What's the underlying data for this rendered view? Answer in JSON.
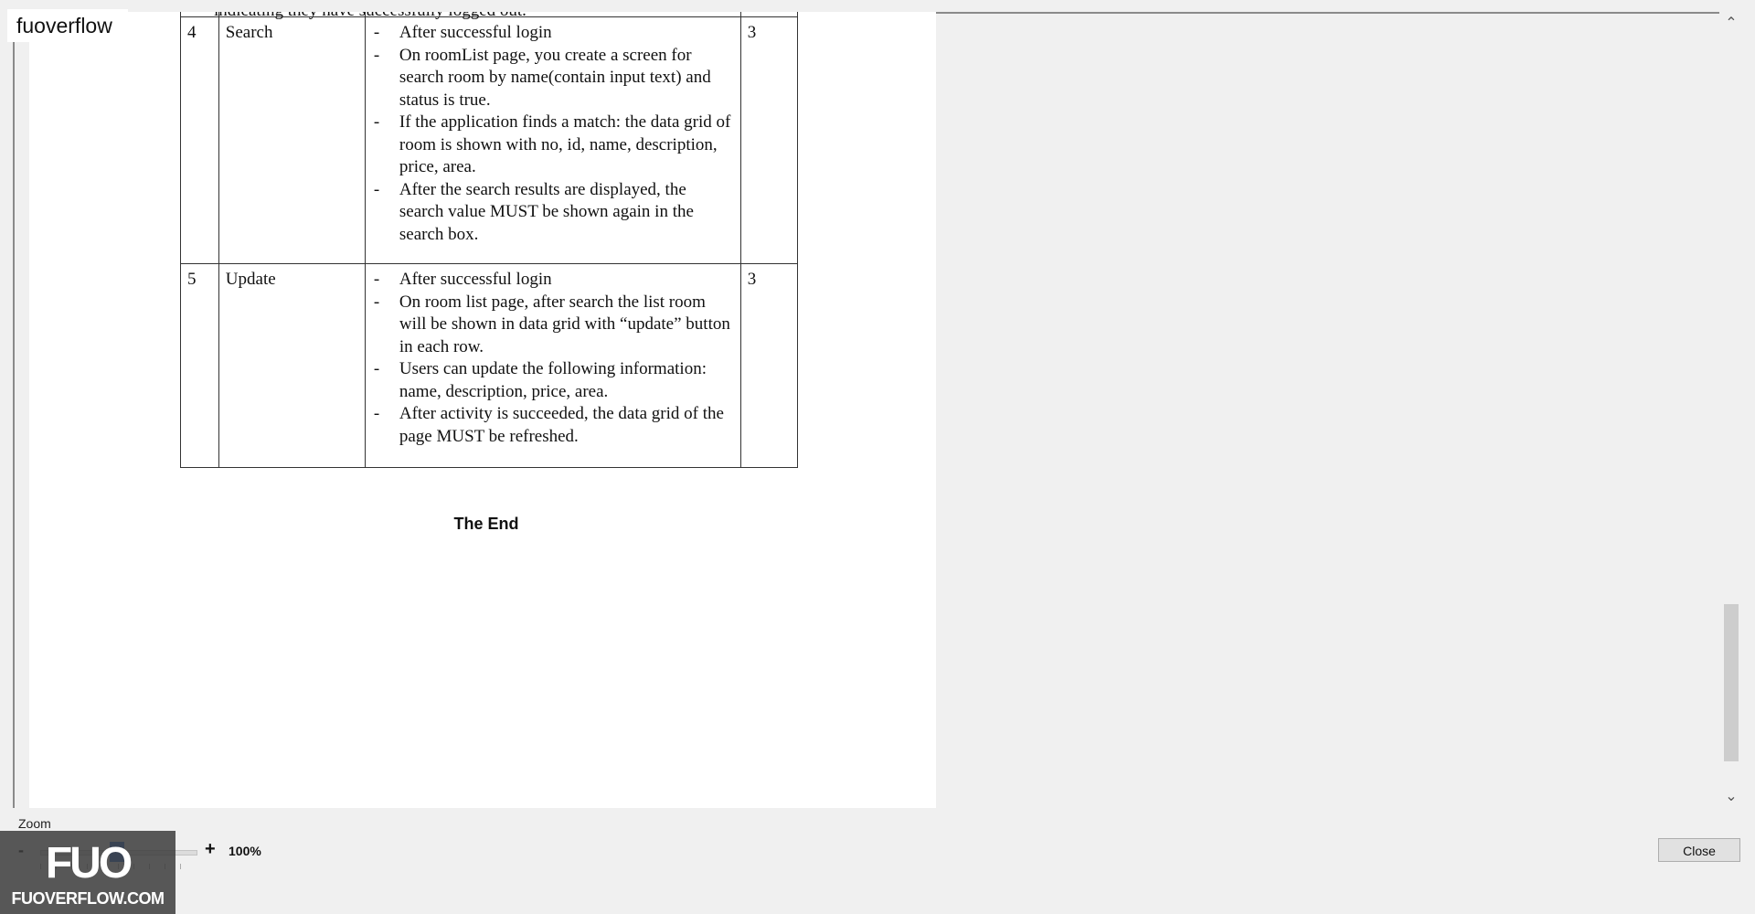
{
  "watermark": {
    "label": "fuoverflow",
    "logo_mark": "FUO",
    "logo_text": "FUOVERFLOW.COM"
  },
  "document": {
    "cut_off_text": "indicating they have successfully logged out.",
    "rows": [
      {
        "no": "4",
        "name": "Search",
        "points": "3",
        "bullets": [
          "After successful login",
          "On roomList page, you create a screen for search room by name(contain input text) and status is true.",
          "If the application finds a match: the data grid of room is shown with no, id, name, description, price, area.",
          "After the search results are displayed, the search value MUST be shown again in the search box."
        ]
      },
      {
        "no": "5",
        "name": "Update",
        "points": "3",
        "bullets": [
          "After successful login",
          "On room list page, after search the list room will be shown in data grid with “update” button in each row.",
          "Users can update the following information: name, description, price, area.",
          "After activity is succeeded, the data grid of the page MUST be refreshed."
        ]
      }
    ],
    "footer": "The End"
  },
  "zoom": {
    "label": "Zoom",
    "minus": "-",
    "plus": "+",
    "value": "100%",
    "level_percent": 100
  },
  "buttons": {
    "close": "Close"
  },
  "icons": {
    "scroll_up": "chevron-up-icon",
    "scroll_down": "chevron-down-icon"
  }
}
